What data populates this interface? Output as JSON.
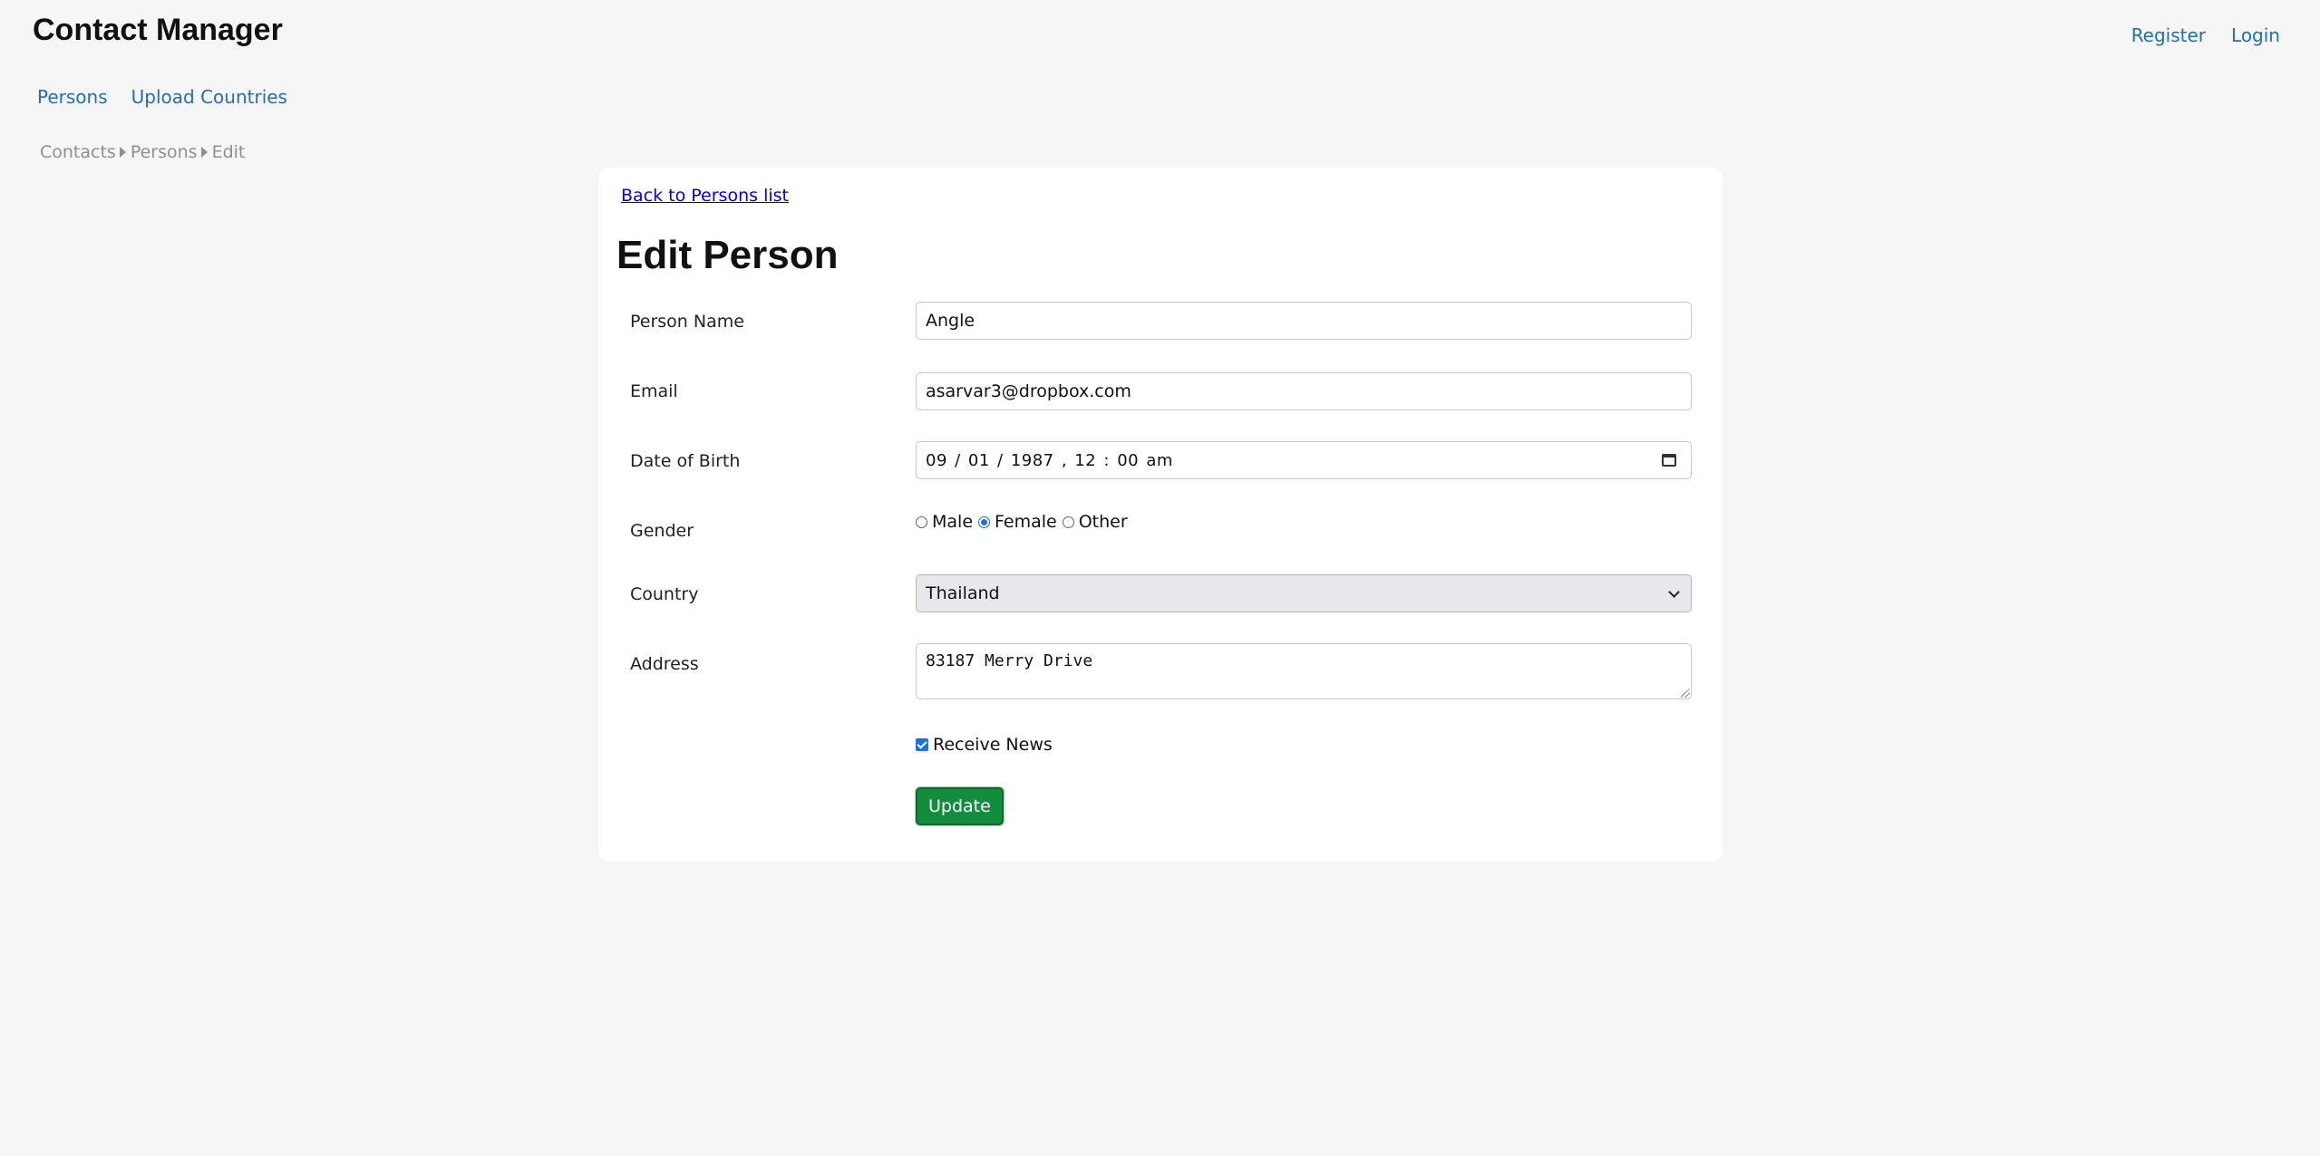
{
  "header": {
    "title": "Contact Manager",
    "auth_links": [
      "Register",
      "Login"
    ]
  },
  "nav": {
    "items": [
      "Persons",
      "Upload Countries"
    ]
  },
  "breadcrumb": {
    "items": [
      "Contacts",
      "Persons",
      "Edit"
    ]
  },
  "form": {
    "back_link": "Back to Persons list",
    "title": "Edit Person",
    "person_name": {
      "label": "Person Name",
      "value": "Angle"
    },
    "email": {
      "label": "Email",
      "value": "asarvar3@dropbox.com"
    },
    "date_of_birth": {
      "label": "Date of Birth",
      "value": "09 / 01 / 1987 ,  12 : 00   am"
    },
    "gender": {
      "label": "Gender",
      "options": [
        "Male",
        "Female",
        "Other"
      ],
      "selected": "Female"
    },
    "country": {
      "label": "Country",
      "value": "Thailand"
    },
    "address": {
      "label": "Address",
      "value": "83187 Merry Drive"
    },
    "receive_news": {
      "label": "Receive News",
      "checked": true
    },
    "submit_label": "Update"
  },
  "colors": {
    "link": "#1f6fb8",
    "button": "#138d3d",
    "accent": "#1a73e8",
    "background": "#f6f6f6"
  }
}
